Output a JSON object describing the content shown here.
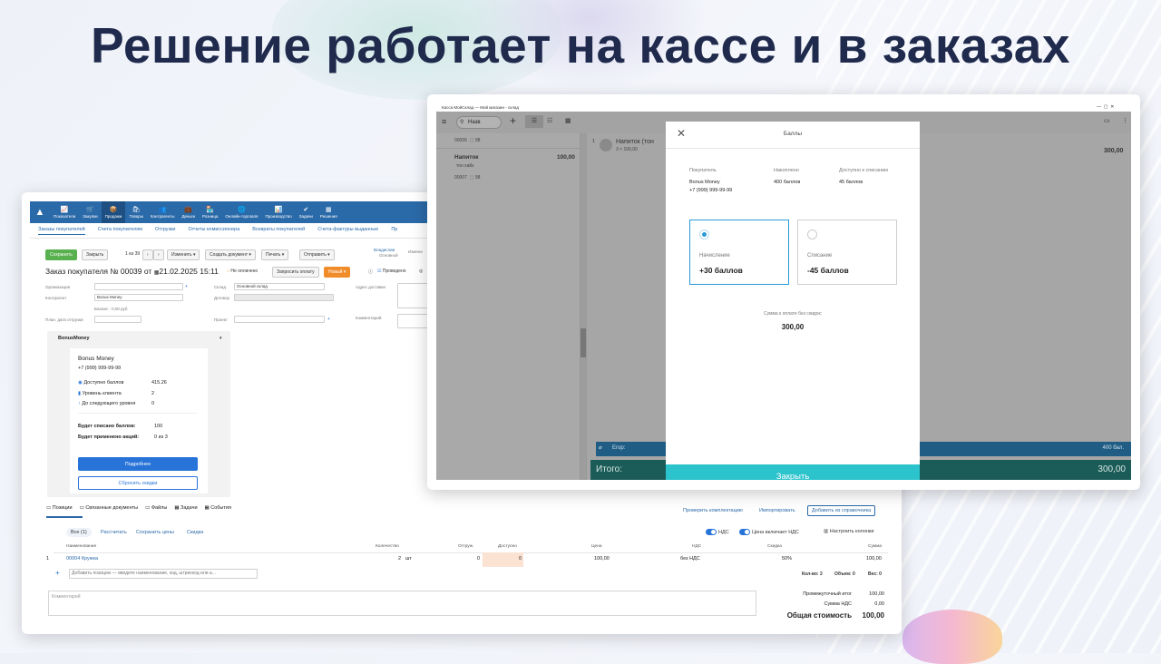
{
  "slide": {
    "title": "Решение работает на кассе и в заказах"
  },
  "order_window": {
    "nav": [
      {
        "label": "Показатели",
        "icon": "📈"
      },
      {
        "label": "Закупки",
        "icon": "🛒"
      },
      {
        "label": "Продажи",
        "icon": "📦",
        "active": true
      },
      {
        "label": "Товары",
        "icon": "🛍"
      },
      {
        "label": "Контрагенты",
        "icon": "👥"
      },
      {
        "label": "Деньги",
        "icon": "💼"
      },
      {
        "label": "Розница",
        "icon": "🏪"
      },
      {
        "label": "Онлайн-торговля",
        "icon": "🌐"
      },
      {
        "label": "Производство",
        "icon": "📊"
      },
      {
        "label": "Задачи",
        "icon": "✔"
      },
      {
        "label": "Решения",
        "icon": "▦"
      }
    ],
    "subnav": [
      "Заказы покупателей",
      "Счета покупателям",
      "Отгрузки",
      "Отчеты комиссионера",
      "Возвраты покупателей",
      "Счета-фактуры выданные",
      "Пр"
    ],
    "toolbar": {
      "save": "Сохранить",
      "close": "Закрыть",
      "pager": "1 из 39",
      "change": "Изменить ▾",
      "create_doc": "Создать документ ▾",
      "print": "Печать ▾",
      "send": "Отправить ▾",
      "owner": "Владислав",
      "owner_sub": "Основной",
      "change_short": "Измене"
    },
    "order": {
      "title_prefix": "Заказ покупателя №",
      "number": "00039",
      "from": "от",
      "date": "21.02.2025 15:11",
      "not_paid": "Не оплачено",
      "request_payment": "Запросить оплату",
      "status": "Новый ▾",
      "posted": "Проведено"
    },
    "fields": {
      "organization": "Организация",
      "counterparty": "Контрагент",
      "counterparty_value": "Bonus Money",
      "balance": "Баланс : 0,00 руб",
      "ship_date": "План. дата отгрузки",
      "warehouse": "Склад",
      "warehouse_value": "Основной склад",
      "contract": "Договор",
      "project": "Проект",
      "delivery": "Адрес доставки",
      "comment": "Комментарий"
    },
    "bonus": {
      "header": "BonusMoney",
      "name": "Bonus Money",
      "phone": "+7 (999) 999-99-99",
      "available_label": "Доступно баллов",
      "available": "415.26",
      "level_label": "Уровень клиента",
      "level": "2",
      "next_label": "До следующего уровня",
      "next": "0",
      "written_label": "Будет списано баллов:",
      "written": "100",
      "promo_label": "Будет применено акций:",
      "promo": "0 из 3",
      "more": "Подробнее",
      "reset": "Сбросить скидки"
    },
    "tabs": [
      "Позиции",
      "Связанные документы",
      "Файлы",
      "Задачи",
      "События"
    ],
    "tab_actions": {
      "check": "Проверить комплектацию",
      "import": "Импортировать",
      "add": "Добавить из справочника"
    },
    "filters": {
      "all": "Все (1)",
      "calc": "Рассчитать",
      "save_prices": "Сохранить цены",
      "discount": "Скидка",
      "vat": "НДС",
      "price_incl": "Цена включает НДС",
      "columns": "Настроить колонки"
    },
    "table": {
      "headers": [
        "Наименование",
        "Количество",
        "Отгруж.",
        "Доступно",
        "Цена",
        "НДС",
        "Скидка",
        "Сумма"
      ],
      "row": {
        "n": "1",
        "name": "00004 Кружка",
        "qty": "2",
        "unit": "шт",
        "shipped": "0",
        "avail": "0",
        "price": "100,00",
        "vat": "без НДС",
        "disc": "50%",
        "sum": "100,00"
      },
      "add_placeholder": "Добавить позицию — введите наименование, код, штрихкод или а...",
      "totals": {
        "count": "Кол-во: 2",
        "volume": "Объем: 0",
        "weight": "Вес: 0"
      }
    },
    "comment_placeholder": "Комментарий",
    "summary": {
      "subtotal_label": "Промежуточный итог",
      "subtotal": "100,00",
      "vat_label": "Сумма НДС",
      "vat": "0,00",
      "total_label": "Общая стоимость",
      "total": "100,00"
    }
  },
  "pos_window": {
    "title": "Касса МойСклад — Мой магазин - склад",
    "search": "Назв",
    "list": [
      {
        "code": "00006",
        "stock": "98"
      },
      {
        "name": "Напиток",
        "sub": "тон хайз",
        "price": "100,00",
        "code": "00007",
        "stock": "98"
      }
    ],
    "cart_item": {
      "n": "1",
      "name": "Напиток (тон",
      "qty": "3 × 100,00",
      "sum": "300,00"
    },
    "customer_bar": {
      "name": "Егор:",
      "points": "400 бал."
    },
    "total_label": "Итого:",
    "total": "300,00",
    "modal": {
      "title": "Баллы",
      "buyer_label": "Покупатель",
      "buyer_name": "Bonus Money",
      "buyer_phone": "+7 (999) 999-99-99",
      "accrued_label": "Накоплено",
      "accrued": "400 баллов",
      "available_label": "Доступно к списанию",
      "available": "45 баллов",
      "opt1_label": "Начисление",
      "opt1_value": "+30 баллов",
      "opt2_label": "Списание",
      "opt2_value": "-45 баллов",
      "sum_label": "Сумма к оплате без скидок:",
      "sum": "300,00",
      "close": "Закрыть"
    }
  }
}
